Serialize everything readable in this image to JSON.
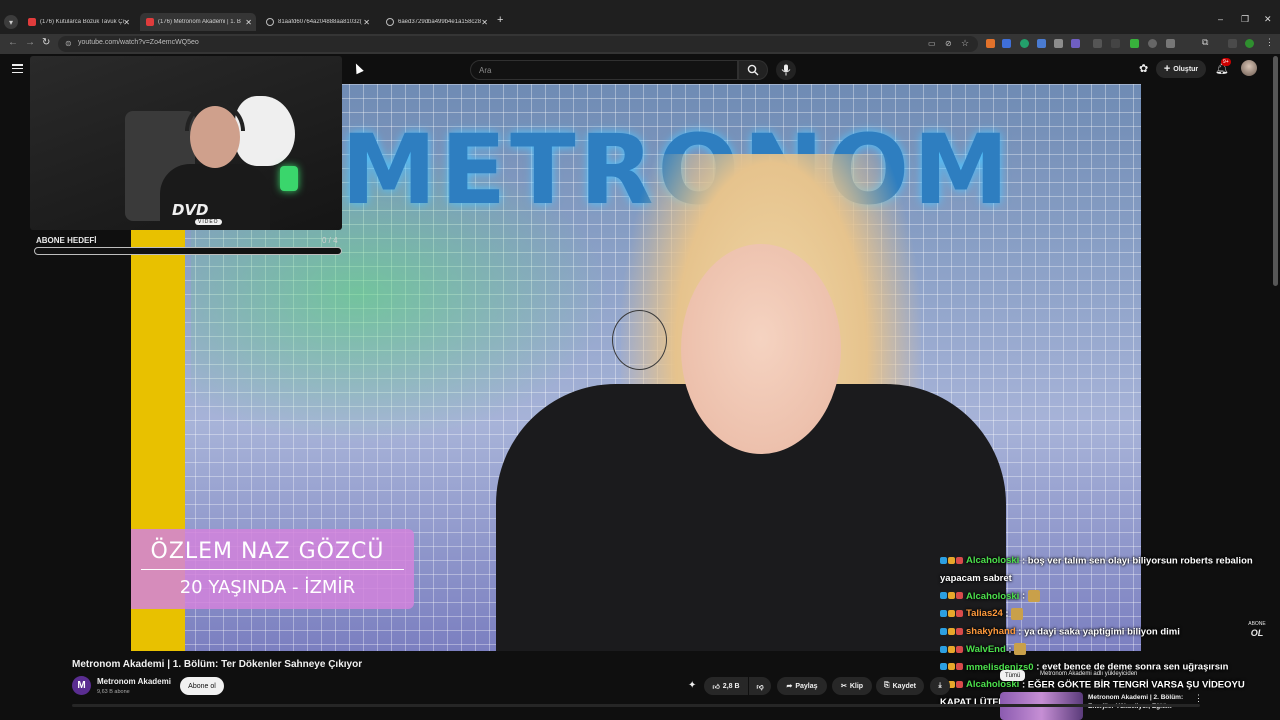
{
  "browser": {
    "tabs": [
      {
        "label": "(176) Kutularca Bozuk Tavuk Çi",
        "icon": "youtube-icon",
        "active": false
      },
      {
        "label": "(176) Metronom Akademi | 1. B",
        "icon": "youtube-icon",
        "active": true
      },
      {
        "label": "81aafd60764a204888aa81032(",
        "icon": "globe-icon",
        "active": false
      },
      {
        "label": "6aed3729dba499b4e1a158c28",
        "icon": "globe-icon",
        "active": false
      }
    ],
    "url": "youtube.com/watch?v=Zo4emcWQ5eo",
    "new_tab": "+",
    "window_controls": {
      "minimize": "–",
      "maximize": "❐",
      "close": "✕"
    }
  },
  "youtube_header": {
    "search_placeholder": "Ara",
    "create_label": "Oluştur",
    "notification_count": "9+"
  },
  "video": {
    "brand_text": "METRONOM",
    "lower_third_name": "ÖZLEM NAZ GÖZCÜ",
    "lower_third_subtitle": "20 YAŞINDA - İZMİR",
    "title": "Metronom Akademi | 1. Bölüm: Ter Dökenler Sahneye Çıkıyor"
  },
  "overlay": {
    "webcam_logo": "DVD",
    "webcam_logo_sub": "VIDEO",
    "goal_label": "ABONE HEDEFİ",
    "goal_count": "0 / 4",
    "goal_progress": 0,
    "abone_ol_main": "OL",
    "abone_ol_small": "ABONE"
  },
  "chat": [
    {
      "user": "Alcaholoski",
      "color": "#4ce04c",
      "text": "boş ver talım sen olayı biliyorsun roberts rebalion yapacam sabret",
      "emote": false
    },
    {
      "user": "Alcaholoski",
      "color": "#4ce04c",
      "text": "",
      "emote": true
    },
    {
      "user": "Talias24",
      "color": "#ff9a3c",
      "text": "",
      "emote": true
    },
    {
      "user": "shakyhand",
      "color": "#ff9a3c",
      "text": "ya dayi saka yaptigimi biliyon dimi",
      "emote": false
    },
    {
      "user": "WalvEnd",
      "color": "#4ce04c",
      "text": "",
      "emote": true
    },
    {
      "user": "mmelisdenizs0",
      "color": "#4ce04c",
      "text": "evet bence de deme sonra sen uğraşırsın",
      "emote": false
    },
    {
      "user": "Alcaholoski",
      "color": "#4ce04c",
      "text": "EĞER GÖKTE BİR TENGRİ VARSA ŞU VİDEOYU KAPAT LÜTFEN",
      "emote": false
    }
  ],
  "channel": {
    "initial": "M",
    "name": "Metronom Akademi",
    "subscribers": "9,63 B abone",
    "subscribe_label": "Abone ol"
  },
  "actions": {
    "like_count": "2,8 B",
    "share": "Paylaş",
    "clip": "Klip",
    "save": "Kaydet"
  },
  "recommendations": {
    "chip": "Tümü",
    "chip2": "Metronom Akademi adlı yükleyiciden",
    "item_title": "Metronom Akademi | 2. Bölüm: Enerjiler Yükseliyor, Eğitim"
  },
  "colors": {
    "accent_red": "#cc0000",
    "yt_background": "#0f0f0f"
  }
}
